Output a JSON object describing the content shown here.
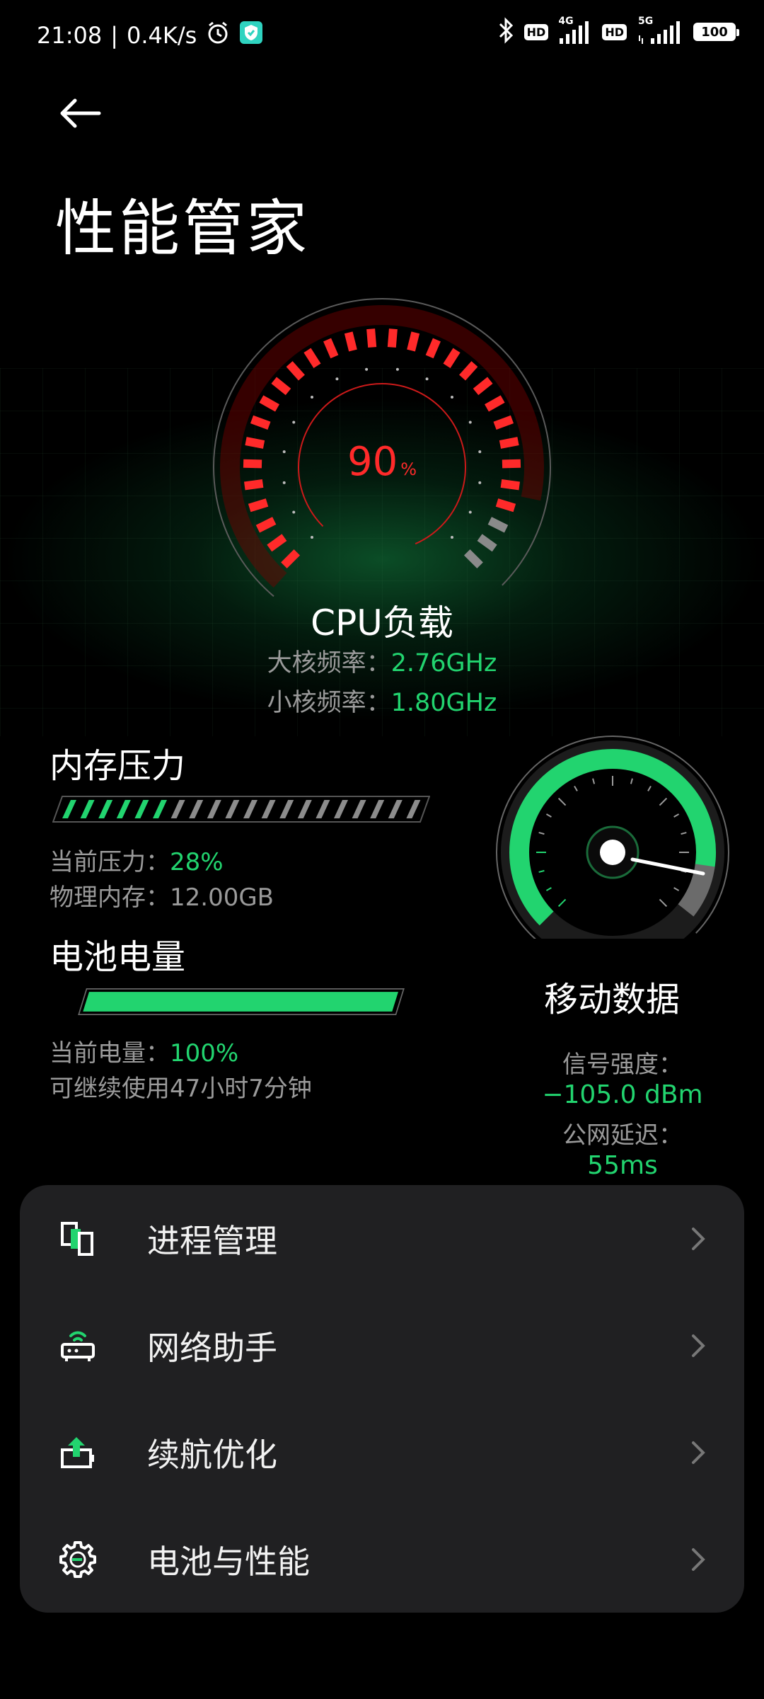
{
  "status_bar": {
    "time": "21:08",
    "separator": "|",
    "net_speed": "0.4K/s",
    "hd1": "HD",
    "net1": "4G",
    "hd2": "HD",
    "net2": "5G",
    "battery": "100"
  },
  "header": {
    "title": "性能管家"
  },
  "cpu": {
    "load_value": "90",
    "load_unit": "%",
    "load_fraction": 0.9,
    "title": "CPU负载",
    "big_core_label": "大核频率：",
    "big_core_value": "2.76GHz",
    "small_core_label": "小核频率：",
    "small_core_value": "1.80GHz"
  },
  "memory": {
    "title": "内存压力",
    "pressure_label": "当前压力：",
    "pressure_value": "28%",
    "pressure_fraction": 0.28,
    "physical_label": "物理内存：",
    "physical_value": "12.00GB"
  },
  "battery": {
    "title": "电池电量",
    "level_label": "当前电量：",
    "level_value": "100%",
    "level_fraction": 1.0,
    "remaining": "可继续使用47小时7分钟"
  },
  "mobile_data": {
    "title": "移动数据",
    "signal_label": "信号强度：",
    "signal_value": "−105.0 dBm",
    "latency_label": "公网延迟：",
    "latency_value": "55ms"
  },
  "menu": {
    "items": [
      {
        "label": "进程管理",
        "icon": "process-icon"
      },
      {
        "label": "网络助手",
        "icon": "router-icon"
      },
      {
        "label": "续航优化",
        "icon": "battery-boost-icon"
      },
      {
        "label": "电池与性能",
        "icon": "gear-icon"
      }
    ]
  },
  "colors": {
    "accent_green": "#22d46f",
    "cpu_red": "#ff2a2a",
    "card_bg": "#202022"
  }
}
